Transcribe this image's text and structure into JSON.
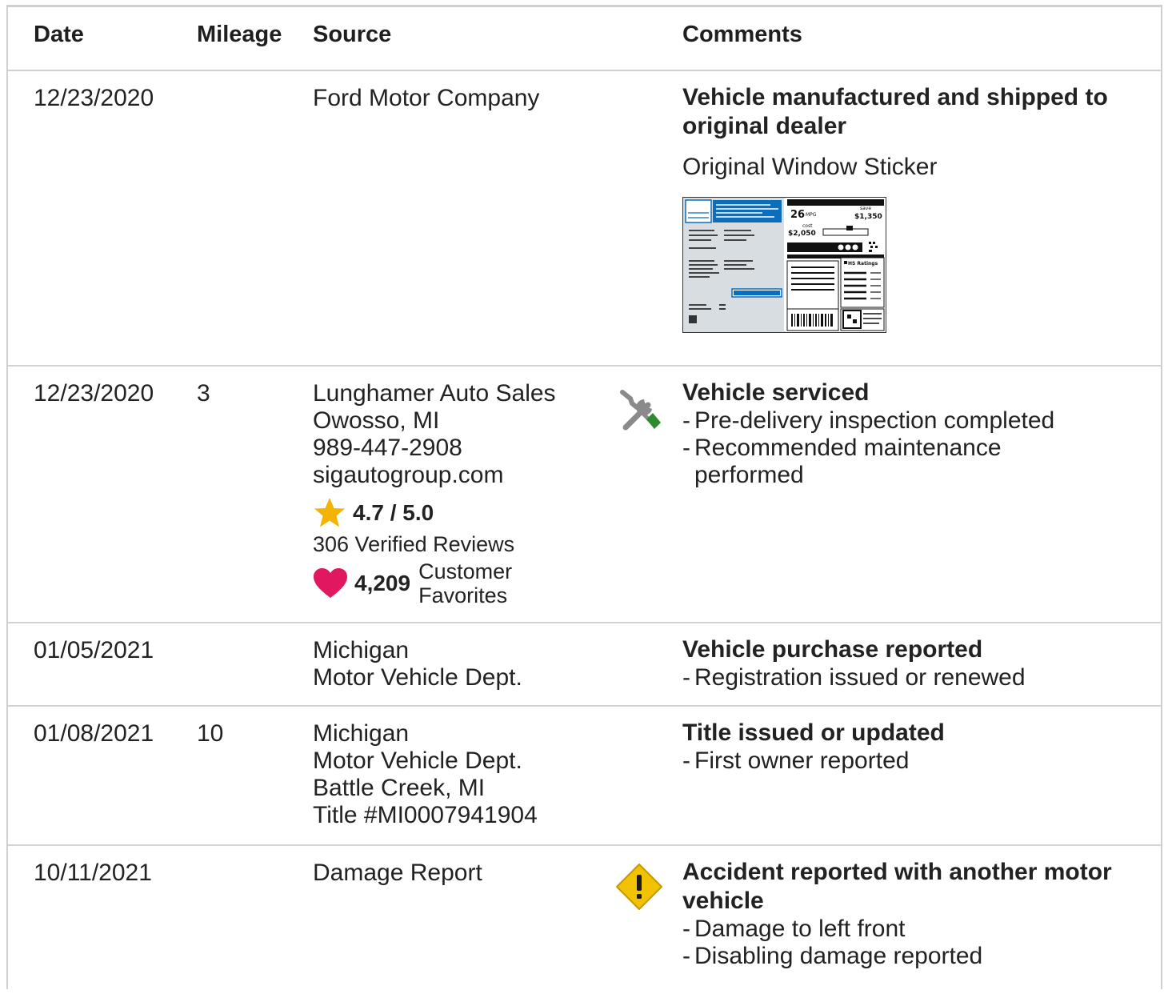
{
  "header": {
    "date": "Date",
    "mileage": "Mileage",
    "source": "Source",
    "comments": "Comments"
  },
  "rows": [
    {
      "date": "12/23/2020",
      "mileage": "",
      "source": [
        "Ford Motor Company"
      ],
      "title": "Vehicle manufactured and shipped to original dealer",
      "sticker_label": "Original Window Sticker",
      "sticker": {
        "mpg": "26",
        "mpg_unit": "MPG",
        "save_label": "save",
        "save": "$1,350",
        "cost_label": "cost",
        "cost": "$2,050",
        "ratings_label": "HS Ratings"
      }
    },
    {
      "date": "12/23/2020",
      "mileage": "3",
      "source": [
        "Lunghamer Auto Sales",
        "Owosso, MI",
        "989-447-2908",
        "sigautogroup.com"
      ],
      "rating": "4.7 / 5.0",
      "reviews": "306 Verified Reviews",
      "favorites_count": "4,209",
      "favorites_label_1": "Customer",
      "favorites_label_2": "Favorites",
      "icon": "service-tools-icon",
      "title": "Vehicle serviced",
      "bullets": [
        "Pre-delivery inspection completed",
        "Recommended maintenance performed"
      ]
    },
    {
      "date": "01/05/2021",
      "mileage": "",
      "source": [
        "Michigan",
        "Motor Vehicle Dept."
      ],
      "title": "Vehicle purchase reported",
      "bullets": [
        "Registration issued or renewed"
      ]
    },
    {
      "date": "01/08/2021",
      "mileage": "10",
      "source": [
        "Michigan",
        "Motor Vehicle Dept.",
        "Battle Creek, MI",
        "Title #MI0007941904"
      ],
      "title": "Title issued or updated",
      "bullets": [
        "First owner reported"
      ]
    },
    {
      "date": "10/11/2021",
      "mileage": "",
      "source": [
        "Damage Report"
      ],
      "icon": "warning-icon",
      "title": "Accident reported with another motor vehicle",
      "bullets": [
        "Damage to left front",
        "Disabling damage reported"
      ]
    }
  ],
  "colors": {
    "star": "#f5b301",
    "heart": "#e0185f",
    "warning": "#f2c200",
    "wrench_handle": "#2e8b2e",
    "sticker_blue": "#0a6ebd"
  }
}
